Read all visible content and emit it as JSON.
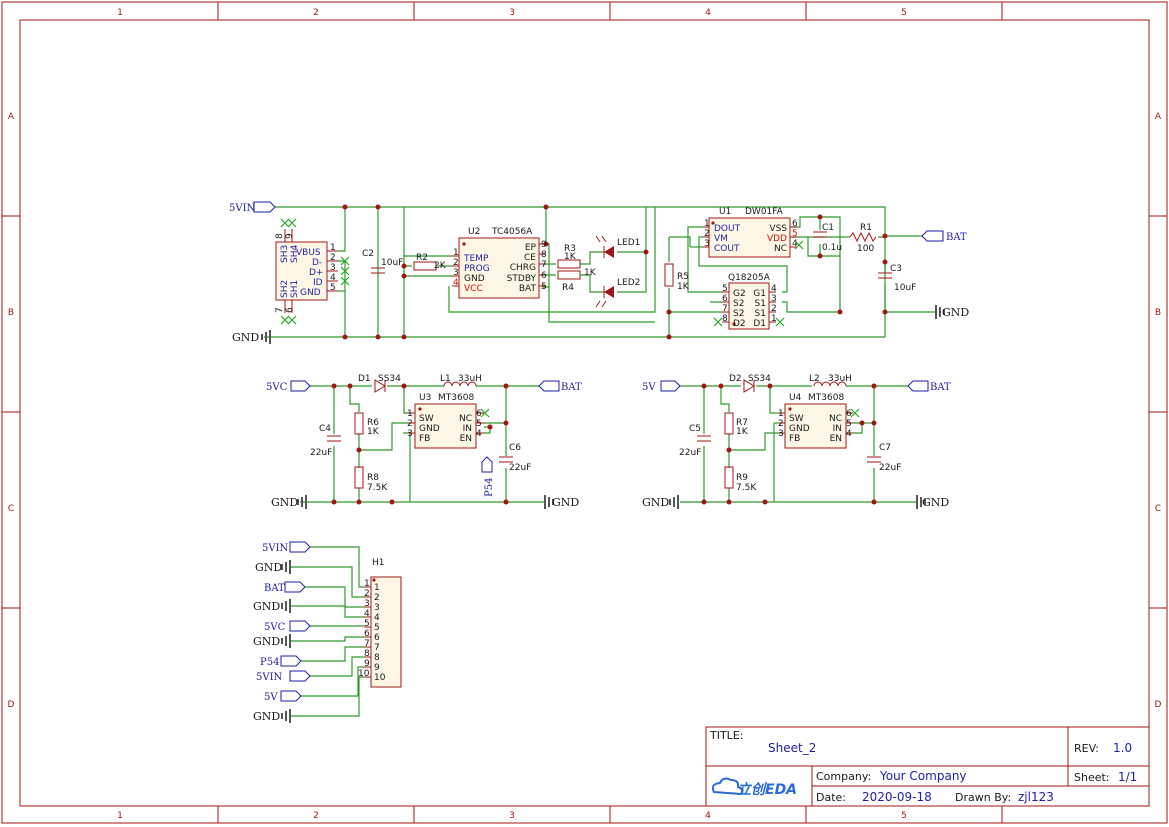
{
  "frame": {
    "columns": [
      "1",
      "2",
      "3",
      "4",
      "5"
    ],
    "rows": [
      "A",
      "B",
      "C",
      "D"
    ]
  },
  "title_block": {
    "title_label": "TITLE:",
    "title": "Sheet_2",
    "rev_label": "REV:",
    "rev": "1.0",
    "company_label": "Company:",
    "company": "Your Company",
    "sheet_label": "Sheet:",
    "sheet": "1/1",
    "date_label": "Date:",
    "date": "2020-09-18",
    "drawn_label": "Drawn By:",
    "drawn": "zjl123",
    "logo": "立创EDA"
  },
  "charger": {
    "net_5vin": "5VIN",
    "usb": {
      "pins": [
        "VBUS",
        "D-",
        "D+",
        "ID",
        "GND"
      ],
      "nums": [
        "1",
        "2",
        "3",
        "4",
        "5"
      ],
      "shields": [
        "SH3",
        "SH4",
        "SH2",
        "SH1"
      ],
      "snums": [
        "8",
        "9",
        "7",
        "6"
      ]
    },
    "c2": {
      "ref": "C2",
      "value": "10uF"
    },
    "r2": {
      "ref": "R2",
      "value": "2K"
    },
    "u2": {
      "ref": "U2",
      "part": "TC4056A",
      "left_pins": [
        "TEMP",
        "PROG",
        "GND",
        "VCC"
      ],
      "left_nums": [
        "1",
        "2",
        "3",
        "4"
      ],
      "right_pins": [
        "EP",
        "CE",
        "CHRG",
        "STDBY",
        "BAT"
      ],
      "right_nums": [
        "9",
        "8",
        "7",
        "6",
        "5"
      ]
    },
    "r3": {
      "ref": "R3",
      "value": "1K"
    },
    "r4": {
      "ref": "R4",
      "value": "1K"
    },
    "led1": "LED1",
    "led2": "LED2",
    "u1": {
      "ref": "U1",
      "part": "DW01FA",
      "left_pins": [
        "DOUT",
        "VM",
        "COUT"
      ],
      "left_nums": [
        "1",
        "2",
        "3"
      ],
      "right_pins": [
        "VSS",
        "VDD",
        "NC"
      ],
      "right_nums": [
        "6",
        "5",
        "4"
      ]
    },
    "c1": {
      "ref": "C1",
      "value": "0.1u"
    },
    "r1": {
      "ref": "R1",
      "value": "100"
    },
    "net_bat": "BAT",
    "r5": {
      "ref": "R5",
      "value": "1K"
    },
    "q1": {
      "part": "Q18205A",
      "left_pins": [
        "G2",
        "S2",
        "S2",
        "D2"
      ],
      "left_nums": [
        "5",
        "6",
        "7",
        "8"
      ],
      "right_pins": [
        "G1",
        "S1",
        "S1",
        "D1"
      ],
      "right_nums": [
        "4",
        "3",
        "2",
        "1"
      ]
    },
    "c3": {
      "ref": "C3",
      "value": "10uF"
    },
    "gnd_left": "GND",
    "gnd_right": "GND"
  },
  "boost1": {
    "net_in": "5VC",
    "d": {
      "ref": "D1",
      "part": "SS34"
    },
    "l": {
      "ref": "L1",
      "value": "33uH"
    },
    "net_bat": "BAT",
    "u": {
      "ref": "U3",
      "part": "MT3608",
      "left_pins": [
        "SW",
        "GND",
        "FB"
      ],
      "left_nums": [
        "1",
        "2",
        "3"
      ],
      "right_pins": [
        "NC",
        "IN",
        "EN"
      ],
      "right_nums": [
        "6",
        "5",
        "4"
      ]
    },
    "c_in": {
      "ref": "C4",
      "value": "22uF"
    },
    "r_top": {
      "ref": "R6",
      "value": "1K"
    },
    "r_bot": {
      "ref": "R8",
      "value": "7.5K"
    },
    "c_out": {
      "ref": "C6",
      "value": "22uF"
    },
    "net_p54": "P54",
    "gnd_left": "GND",
    "gnd_right": "GND"
  },
  "boost2": {
    "net_in": "5V",
    "d": {
      "ref": "D2",
      "part": "SS34"
    },
    "l": {
      "ref": "L2",
      "value": "33uH"
    },
    "net_bat": "BAT",
    "u": {
      "ref": "U4",
      "part": "MT3608",
      "left_pins": [
        "SW",
        "GND",
        "FB"
      ],
      "left_nums": [
        "1",
        "2",
        "3"
      ],
      "right_pins": [
        "NC",
        "IN",
        "EN"
      ],
      "right_nums": [
        "6",
        "5",
        "4"
      ]
    },
    "c_in": {
      "ref": "C5",
      "value": "22uF"
    },
    "r_top": {
      "ref": "R7",
      "value": "1K"
    },
    "r_bot": {
      "ref": "R9",
      "value": "7.5K"
    },
    "c_out": {
      "ref": "C7",
      "value": "22uF"
    },
    "gnd_left": "GND",
    "gnd_right": "GND"
  },
  "header": {
    "ref": "H1",
    "pins": [
      "1",
      "2",
      "3",
      "4",
      "5",
      "6",
      "7",
      "8",
      "9",
      "10"
    ],
    "nets": [
      "5VIN",
      "GND",
      "BAT",
      "GND",
      "5VC",
      "GND",
      "P54",
      "5VIN",
      "5V",
      "GND"
    ]
  }
}
